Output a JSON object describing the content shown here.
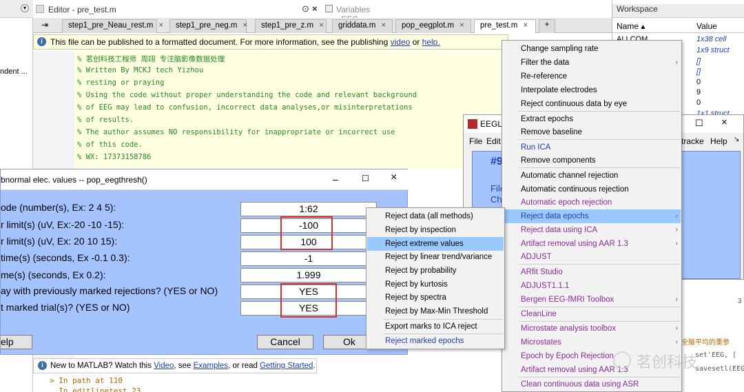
{
  "editor": {
    "title": "Editor - pre_test.m",
    "variables_title": "Variables - EEG",
    "tabs": [
      "step1_pre_Neau_rest.m",
      "step1_pre_neg.m",
      "step1_pre_z.m",
      "griddata.m",
      "pop_eegplot.m",
      "pre_test.m"
    ],
    "add_tab": "+",
    "info_text": "This file can be published to a formatted document. For more information, see the publishing",
    "info_link1": "video",
    "info_or": "or",
    "info_link2": "help.",
    "code_lines": [
      "% 茗创科技工程师 周翊 专注脑影像数据处理",
      "% Written By MCKJ tech Yizhou",
      "% resting or praying",
      "% Using the code without proper understanding the code and relevant background",
      "% of EEG may lead to confusion, incorrect data analyses,or misinterpretations",
      "% of results.",
      "% The author assumes NO responsibility for inappropriate or incorrect use",
      "% of this code.",
      "% WX:         17373158786"
    ]
  },
  "left_panel": {
    "snippet": "ndent ..."
  },
  "workspace": {
    "title": "Workspace",
    "col_name": "Name ▴",
    "col_value": "Value",
    "rows": [
      {
        "name": "ALLCOM",
        "value": "1x38 cell"
      },
      {
        "name": "",
        "value": "1x9 struct"
      },
      {
        "name": "",
        "value": "[]"
      },
      {
        "name": "",
        "value": "[]"
      },
      {
        "name": "",
        "value": "0"
      },
      {
        "name": "",
        "value": "9"
      },
      {
        "name": "",
        "value": "0"
      },
      {
        "name": "",
        "value": "1x1 struct"
      }
    ],
    "right_snips": [
      "tracke",
      "Help",
      "3"
    ],
    "chinese_snip1": "全脑平均的重参",
    "chinese_snip2": "set'EEG, [",
    "chinese_snip3": "savesetl(EEG,",
    "watermark": "茗创科技"
  },
  "eeglab": {
    "title": "EEGLA",
    "menu_file": "File",
    "menu_edit": "Edit",
    "body_snip": "#9",
    "body_lines": [
      "File",
      "Ch",
      "F"
    ]
  },
  "dialog": {
    "title": "bnormal elec. values -- pop_eegthresh()",
    "labels": [
      "ode (number(s), Ex: 2 4 5):",
      "r limit(s) (uV, Ex:-20 -10 -15):",
      "r limit(s) (uV, Ex: 20 10 15):",
      "time(s) (seconds, Ex -0.1 0.3):",
      "me(s) (seconds, Ex 0.2):",
      "ay with previously marked rejections? (YES or NO)",
      "t marked trial(s)? (YES or NO)"
    ],
    "values": [
      "1:62",
      "-100",
      "100",
      "-1",
      "1.999",
      "YES",
      "YES"
    ],
    "help": "elp",
    "cancel": "Cancel",
    "ok": "Ok"
  },
  "tools_menu": [
    {
      "label": "Change sampling rate",
      "color": "black"
    },
    {
      "label": "Filter the data",
      "color": "black",
      "sub": true
    },
    {
      "label": "Re-reference",
      "color": "black"
    },
    {
      "label": "Interpolate electrodes",
      "color": "black"
    },
    {
      "label": "Reject continuous data by eye",
      "color": "black"
    },
    {
      "label": "Extract epochs",
      "color": "black"
    },
    {
      "label": "Remove baseline",
      "color": "black"
    },
    {
      "label": "Run ICA",
      "color": "blue"
    },
    {
      "label": "Remove components",
      "color": "black"
    },
    {
      "label": "Automatic channel rejection",
      "color": "black"
    },
    {
      "label": "Automatic continuous rejection",
      "color": "black"
    },
    {
      "label": "Automatic epoch rejection",
      "color": "purple"
    },
    {
      "label": "Reject data epochs",
      "color": "blue",
      "sub": true,
      "highlight": true
    },
    {
      "label": "Reject data using ICA",
      "color": "purple",
      "sub": true
    },
    {
      "label": "Artifact removal using AAR 1.3",
      "color": "purple",
      "sub": true
    },
    {
      "label": "ADJUST",
      "color": "purple"
    },
    {
      "label": "ARfit Studio",
      "color": "purple"
    },
    {
      "label": "ADJUST1.1.1",
      "color": "purple"
    },
    {
      "label": "Bergen EEG-fMRI Toolbox",
      "color": "purple",
      "sub": true
    },
    {
      "label": "CleanLine",
      "color": "purple"
    },
    {
      "label": "Microstate analysis toolbox",
      "color": "purple",
      "sub": true
    },
    {
      "label": "Microstates",
      "color": "purple"
    },
    {
      "label": "Epoch by Epoch Rejection",
      "color": "purple"
    },
    {
      "label": "Artifact removal using AAR 1.3",
      "color": "purple"
    },
    {
      "label": "Clean continuous data using ASR",
      "color": "purple"
    }
  ],
  "reject_submenu": [
    {
      "label": "Reject data (all methods)"
    },
    {
      "label": "Reject by inspection"
    },
    {
      "label": "Reject extreme values",
      "highlight": true
    },
    {
      "label": "Reject by linear trend/variance"
    },
    {
      "label": "Reject by probability"
    },
    {
      "label": "Reject by kurtosis"
    },
    {
      "label": "Reject by spectra"
    },
    {
      "label": "Reject by Max-Min Threshold"
    },
    {
      "label": "Export marks to ICA reject"
    },
    {
      "label": "Reject marked epochs",
      "color": "blue"
    }
  ],
  "new_to_matlab": {
    "text1": "New to MATLAB? Watch this",
    "video": "Video",
    "text2": ", see",
    "examples": "Examples",
    "text3": ", or read",
    "getting_started": "Getting Started",
    "end": "."
  },
  "command": {
    "line1": "> In path at 110",
    "line2": "  In editlinetest 23"
  }
}
